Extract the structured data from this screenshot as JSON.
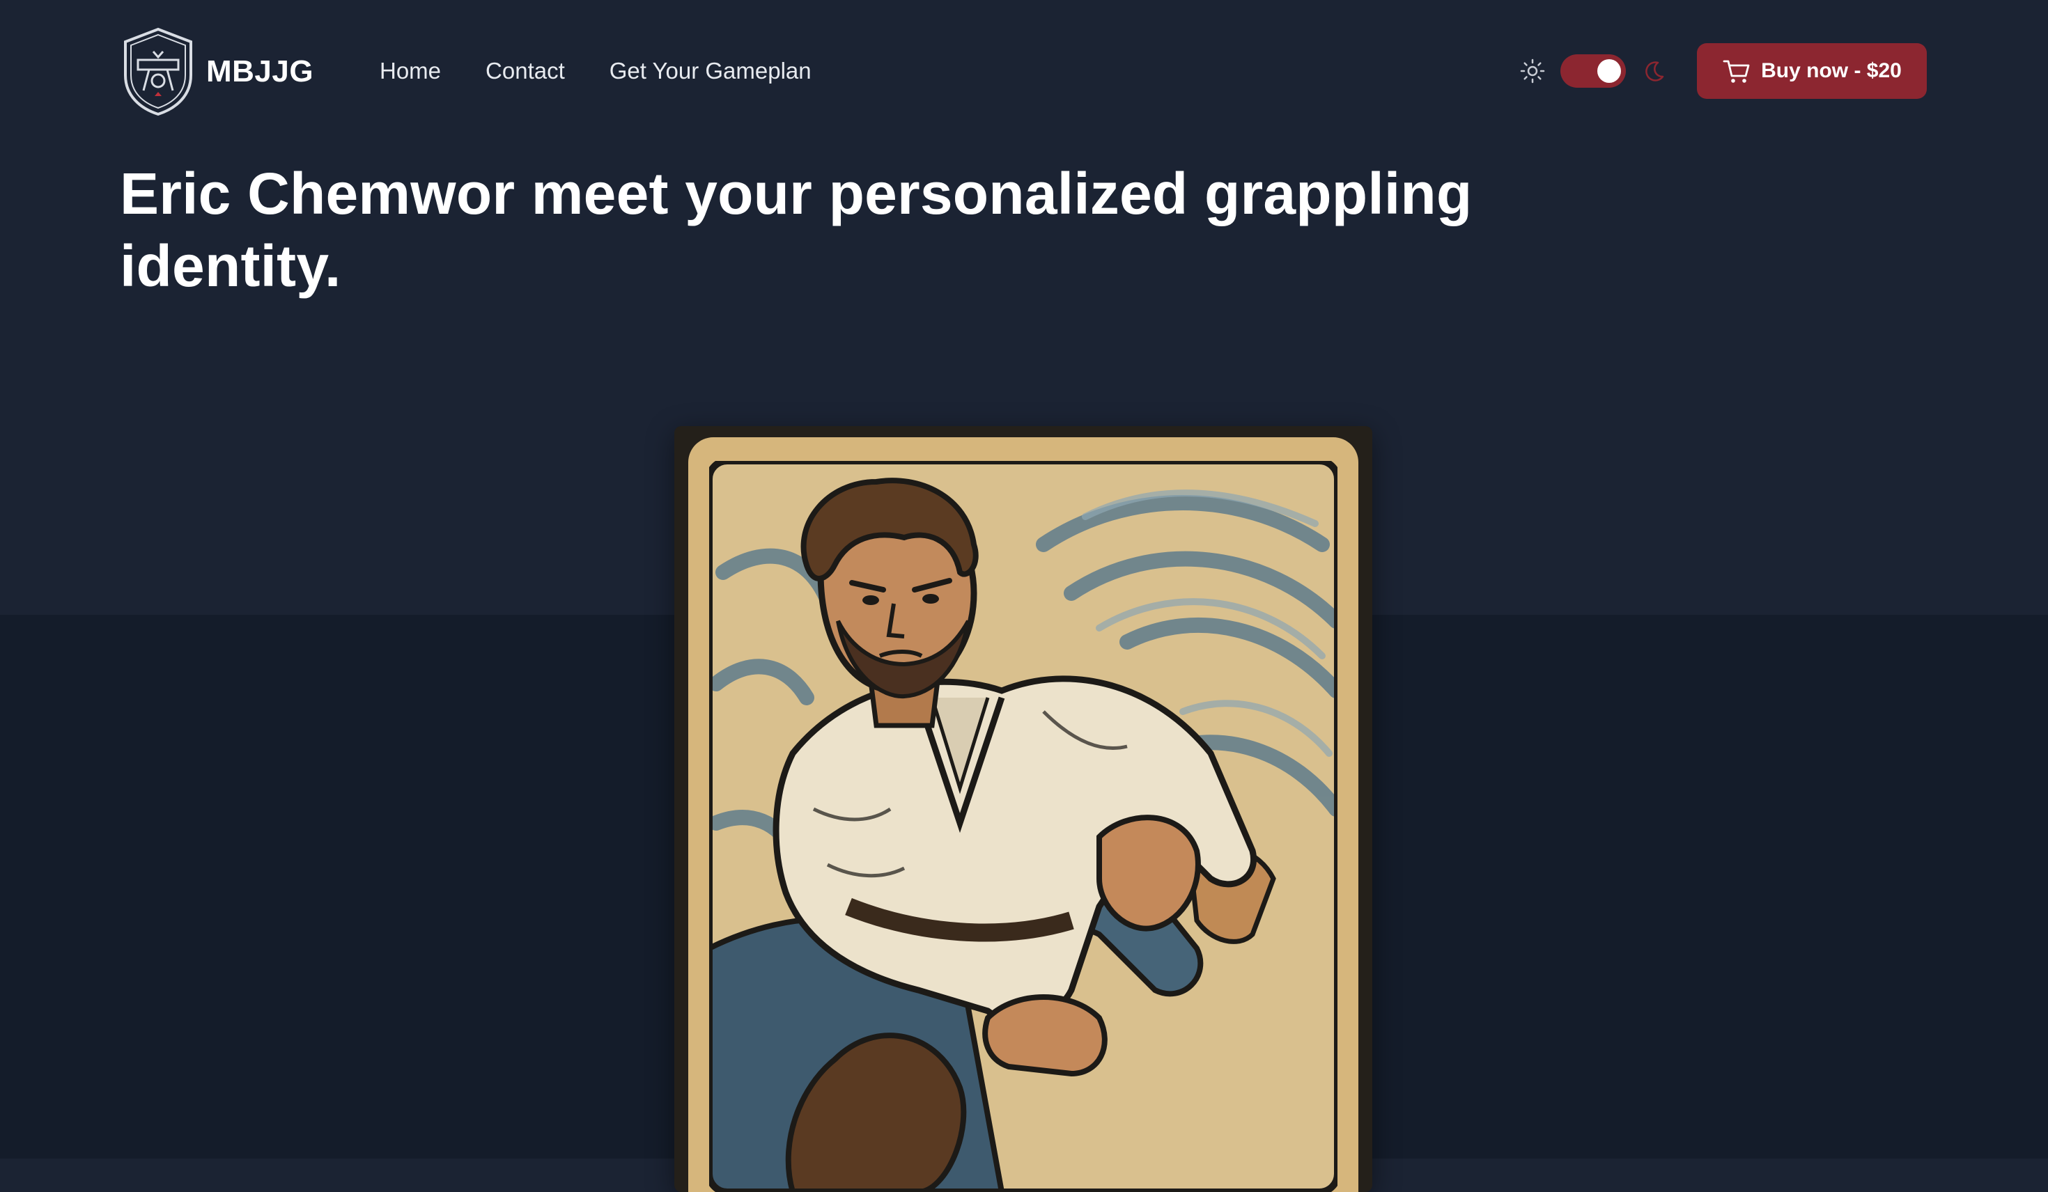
{
  "brand": {
    "name": "MBJJG",
    "logo_icon": "shield-gi-belt-logo-icon"
  },
  "nav": {
    "links": [
      {
        "label": "Home"
      },
      {
        "label": "Contact"
      },
      {
        "label": "Get Your Gameplan"
      }
    ]
  },
  "theme": {
    "light_icon": "sun-icon",
    "dark_icon": "moon-icon",
    "mode": "dark",
    "toggle_on": true
  },
  "cta": {
    "label": "Buy now - $20",
    "icon": "cart-icon"
  },
  "hero": {
    "title": "Eric Chemwor meet your personalized grappling identity."
  },
  "card": {
    "image": "illustrated-grappling-card"
  },
  "colors": {
    "background": "#1b2333",
    "background_lower": "#141c2a",
    "accent": "#8c2630",
    "text": "#ffffff",
    "card_border": "#d6b67c"
  }
}
